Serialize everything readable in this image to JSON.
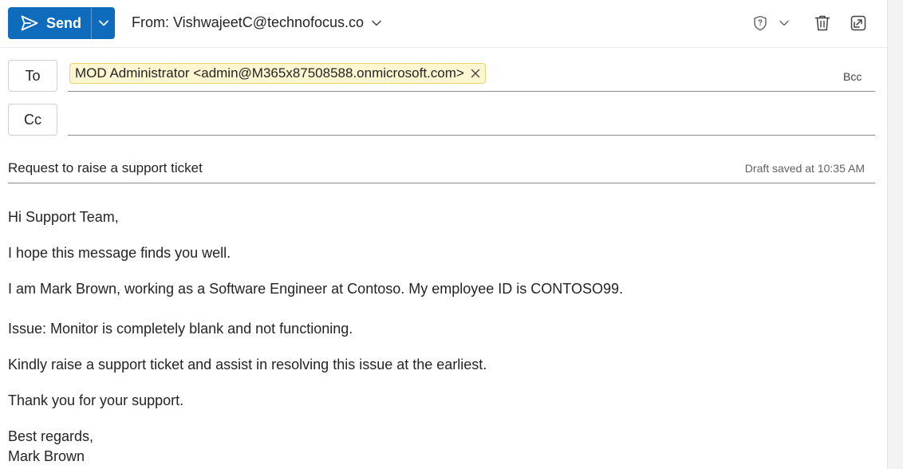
{
  "toolbar": {
    "send_label": "Send",
    "from_prefix": "From:",
    "from_address": "VishwajeetC@technofocus.co",
    "icons": [
      "send-icon",
      "chevron-down-icon",
      "sensitivity-shield-icon",
      "delete-icon",
      "pop-out-icon"
    ]
  },
  "recipients": {
    "to_label": "To",
    "cc_label": "Cc",
    "bcc_label": "Bcc",
    "to_chips": [
      {
        "display": "MOD Administrator <admin@M365x87508588.onmicrosoft.com>"
      }
    ]
  },
  "subject": {
    "value": "Request to raise a support ticket",
    "draft_status": "Draft saved at 10:35 AM"
  },
  "body": {
    "greeting": "Hi Support Team,",
    "line1": "I hope this message finds you well.",
    "line2": "I am Mark Brown, working as a Software Engineer at Contoso. My employee ID is CONTOSO99.",
    "line3": "Issue: Monitor is completely blank and not functioning.",
    "line4": "Kindly raise a support ticket and assist in resolving this issue at the earliest.",
    "line5": "Thank you for your support.",
    "signoff": "Best regards,",
    "signature": "Mark Brown"
  },
  "colors": {
    "accent": "#0f6cbd",
    "chip_background": "#fdf6d0",
    "chip_border": "#e9d46e"
  }
}
